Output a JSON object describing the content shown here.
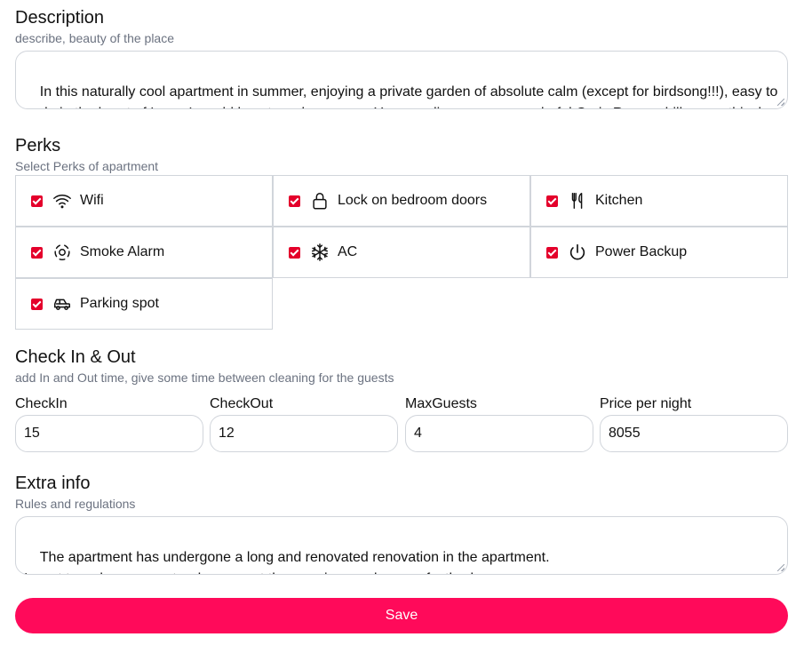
{
  "description": {
    "title": "Description",
    "subtitle": "describe, beauty of the place",
    "value": "In this naturally cool apartment in summer, enjoying a private garden of absolute calm (except for birdsong!!!), easy to park, in the heart of Lyon, I would love to welcome you. You can discover our wonderful Croix Rousse hill: as mythical as it is surprising. Welcome to Lyon!!!"
  },
  "perks": {
    "title": "Perks",
    "subtitle": "Select Perks of apartment",
    "accent_color": "#e4002b",
    "items": [
      {
        "label": "Wifi",
        "icon": "wifi-icon",
        "checked": true
      },
      {
        "label": "Lock on bedroom doors",
        "icon": "lock-icon",
        "checked": true
      },
      {
        "label": "Kitchen",
        "icon": "fork-knife-icon",
        "checked": true
      },
      {
        "label": "Smoke Alarm",
        "icon": "smoke-alarm-icon",
        "checked": true
      },
      {
        "label": "AC",
        "icon": "snowflake-icon",
        "checked": true
      },
      {
        "label": "Power Backup",
        "icon": "power-icon",
        "checked": true
      },
      {
        "label": "Parking spot",
        "icon": "car-icon",
        "checked": true
      }
    ]
  },
  "checkinout": {
    "title": "Check In & Out",
    "subtitle": "add In and Out time, give some time between cleaning for the guests",
    "fields": [
      {
        "label": "CheckIn",
        "value": "15"
      },
      {
        "label": "CheckOut",
        "value": "12"
      },
      {
        "label": "MaxGuests",
        "value": "4"
      },
      {
        "label": "Price per night",
        "value": "8055"
      }
    ]
  },
  "extra": {
    "title": "Extra info",
    "subtitle": "Rules and regulations",
    "value": "The apartment has undergone a long and renovated renovation in the apartment.\nI want to welcome guests who respect the premises and are perfectly clean"
  },
  "save_label": "Save",
  "brand_color": "#ff0a5a"
}
